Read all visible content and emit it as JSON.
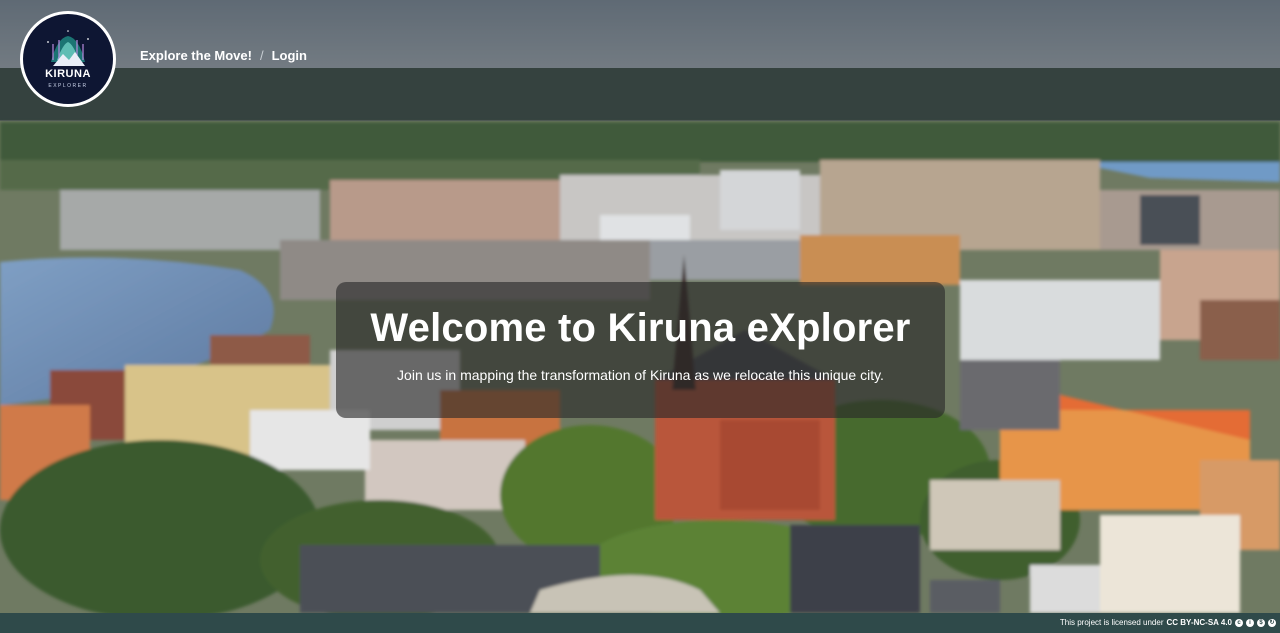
{
  "logo": {
    "name": "KIRUNA",
    "subtitle": "EXPLORER"
  },
  "nav": {
    "links": [
      "Explore the Move!",
      "Login"
    ],
    "separator": "/"
  },
  "hero": {
    "title": "Welcome to Kiruna eXplorer",
    "subtitle": "Join us in mapping the transformation of Kiruna as we relocate this unique city."
  },
  "footer": {
    "text": "This project is licensed under",
    "license": "CC BY-NC-SA 4.0",
    "icons": [
      "cc-icon",
      "by-icon",
      "nc-icon",
      "sa-icon"
    ]
  },
  "colors": {
    "footer_bg": "#2f4a4a",
    "logo_bg": "#0e1633",
    "hero_bg": "rgba(40,40,40,0.62)"
  }
}
